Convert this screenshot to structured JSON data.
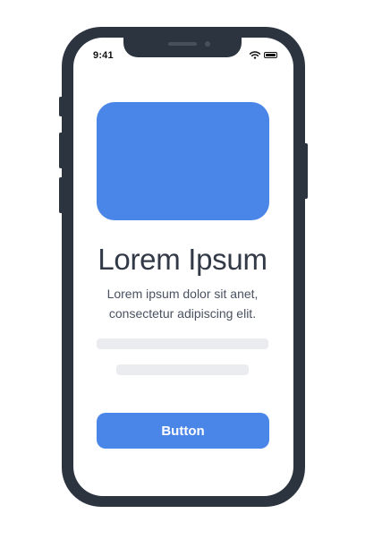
{
  "status_bar": {
    "time": "9:41",
    "icons": [
      "wifi-icon",
      "battery-icon"
    ]
  },
  "hero": {
    "color": "#4a86e8"
  },
  "content": {
    "title": "Lorem Ipsum",
    "description_line1": "Lorem ipsum dolor sit anet,",
    "description_line2": "consectetur adipiscing elit."
  },
  "primary_button": {
    "label": "Button",
    "color": "#4a86e8"
  }
}
